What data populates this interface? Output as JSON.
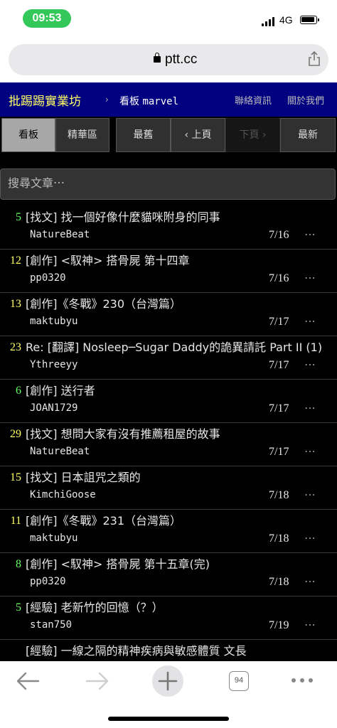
{
  "status_bar": {
    "time": "09:53",
    "network": "4G"
  },
  "browser": {
    "domain": "ptt.cc",
    "tab_count": "94"
  },
  "header": {
    "brand": "批踢踢實業坊",
    "separator": "›",
    "board_prefix": "看板",
    "board_name": "marvel",
    "links": [
      "聯絡資訊",
      "關於我們"
    ]
  },
  "nav": {
    "board": "看板",
    "digest": "精華區",
    "oldest": "最舊",
    "prev": "‹ 上頁",
    "next": "下頁 ›",
    "latest": "最新"
  },
  "search": {
    "placeholder": "搜尋文章⋯"
  },
  "posts": [
    {
      "nrec": "5",
      "nrec_color": "#66ff66",
      "title": "[找文] 找一個好像什麼貓咪附身的同事",
      "author": "NatureBeat",
      "date": "7/16"
    },
    {
      "nrec": "12",
      "nrec_color": "#ffff66",
      "title": "[創作] <馭神> 搭骨屍 第十四章",
      "author": "pp0320",
      "date": "7/16"
    },
    {
      "nrec": "13",
      "nrec_color": "#ffff66",
      "title": "[創作]《冬戰》230（台灣篇）",
      "author": "maktubyu",
      "date": "7/17"
    },
    {
      "nrec": "23",
      "nrec_color": "#ffff66",
      "title": "Re: [翻譯] Nosleep─Sugar Daddy的詭異請託 Part II (1)",
      "author": "Ythreeyy",
      "date": "7/17"
    },
    {
      "nrec": "6",
      "nrec_color": "#66ff66",
      "title": "[創作] 送行者",
      "author": "JOAN1729",
      "date": "7/17"
    },
    {
      "nrec": "29",
      "nrec_color": "#ffff66",
      "title": "[找文] 想問大家有沒有推薦租屋的故事",
      "author": "NatureBeat",
      "date": "7/17"
    },
    {
      "nrec": "15",
      "nrec_color": "#ffff66",
      "title": "[找文] 日本詛咒之類的",
      "author": "KimchiGoose",
      "date": "7/18"
    },
    {
      "nrec": "11",
      "nrec_color": "#ffff66",
      "title": "[創作]《冬戰》231（台灣篇）",
      "author": "maktubyu",
      "date": "7/18"
    },
    {
      "nrec": "8",
      "nrec_color": "#66ff66",
      "title": "[創作] <馭神> 搭骨屍 第十五章(完)",
      "author": "pp0320",
      "date": "7/18"
    },
    {
      "nrec": "5",
      "nrec_color": "#66ff66",
      "title": "[經驗] 老新竹的回憶（？）",
      "author": "stan750",
      "date": "7/19"
    },
    {
      "nrec": "",
      "nrec_color": "#66ff66",
      "title": "[經驗] 一線之隔的精神疾病與敏感體質 文長",
      "author": "",
      "date": ""
    }
  ],
  "more_label": "⋯"
}
